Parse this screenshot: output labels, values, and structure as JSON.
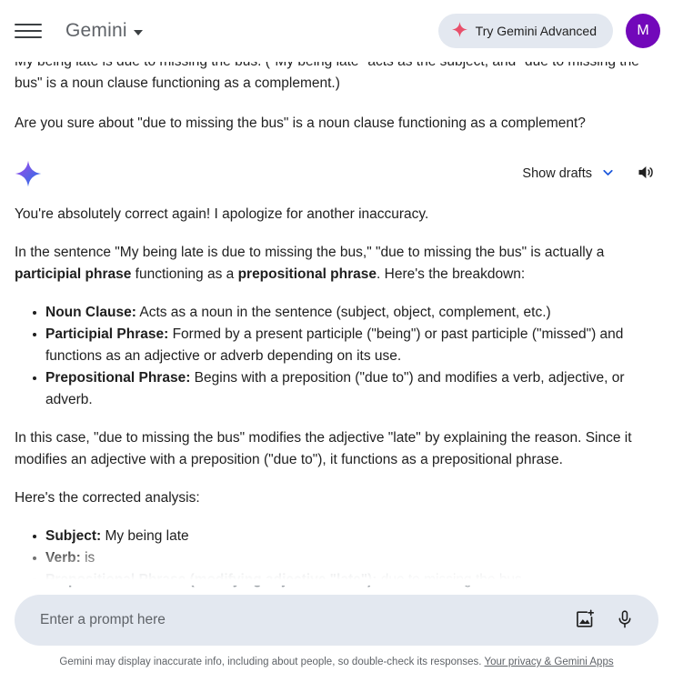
{
  "header": {
    "menu_icon": "hamburger-menu-icon",
    "brand": "Gemini",
    "brand_caret_icon": "caret-down-icon",
    "advanced_button": {
      "label": "Try Gemini Advanced",
      "icon": "sparkle-star-icon",
      "icon_color": "#E8506B",
      "background": "#E3E8F0"
    },
    "avatar": {
      "initial": "M",
      "background": "#7208BA",
      "text_color": "#FFFFFF"
    }
  },
  "conversation": {
    "user_messages": [
      "My being late is due to missing the bus. (\"My being late\" acts as the subject, and \"due to missing the bus\" is a noun clause functioning as a complement.)",
      "Are you sure about \"due to missing the bus\" is a noun clause functioning as a complement?"
    ],
    "model_header": {
      "logo_icon": "gemini-sparkle-icon",
      "logo_gradient_from": "#A142F4",
      "logo_gradient_to": "#1A73E8",
      "drafts_label": "Show drafts",
      "drafts_chevron_icon": "chevron-down-icon",
      "drafts_chevron_color": "#1A56DB",
      "speaker_icon": "volume-speaker-icon"
    },
    "response": {
      "para1": "You're absolutely correct again! I apologize for another inaccuracy.",
      "para2_part1": "In the sentence \"My being late is due to missing the bus,\"  \"due to missing the bus\" is actually a ",
      "para2_bold1": "participial phrase",
      "para2_part2": " functioning as a ",
      "para2_bold2": "prepositional phrase",
      "para2_part3": ". Here's the breakdown:",
      "definitions": [
        {
          "term": "Noun Clause:",
          "text": " Acts as a noun in the sentence (subject, object, complement, etc.)"
        },
        {
          "term": "Participial Phrase:",
          "text": " Formed by a present participle (\"being\") or past participle (\"missed\") and functions as an adjective or adverb depending on its use."
        },
        {
          "term": "Prepositional Phrase:",
          "text": " Begins with a preposition (\"due to\") and modifies a verb, adjective, or adverb."
        }
      ],
      "para3": "In this case, \"due to missing the bus\" modifies the adjective \"late\" by explaining the reason. Since it modifies an adjective with a preposition (\"due to\"), it functions as a prepositional phrase.",
      "para4": "Here's the corrected analysis:",
      "analysis": [
        {
          "term": "Subject:",
          "text": " My being late",
          "faded": false
        },
        {
          "term": "Verb:",
          "text": " is",
          "faded": false
        },
        {
          "term": "Prepositional Phrase (modifying adjective \"late\"):",
          "text": " due to missing the bus",
          "faded": true
        }
      ]
    }
  },
  "composer": {
    "placeholder": "Enter a prompt here",
    "value": "",
    "image_icon": "add-image-icon",
    "mic_icon": "microphone-icon",
    "background": "#E3E8F0"
  },
  "footer": {
    "disclaimer": "Gemini may display inaccurate info, including about people, so double-check its responses.",
    "link": "Your privacy & Gemini Apps"
  }
}
